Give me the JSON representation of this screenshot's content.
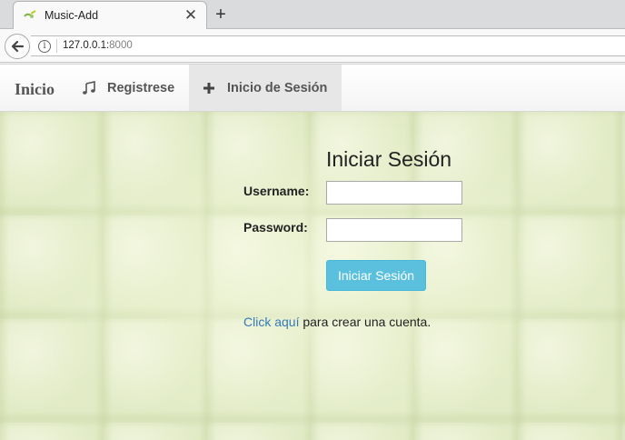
{
  "browser": {
    "tab_title": "Music-Add",
    "close_glyph": "✕",
    "newtab_glyph": "+",
    "url_host": "127.0.0.1:",
    "url_port": "8000"
  },
  "navbar": {
    "brand": "Inicio",
    "register_label": "Registrese",
    "register_icon": "music-note-icon",
    "login_label": "Inicio de Sesión",
    "login_icon": "plus-icon"
  },
  "login": {
    "title": "Iniciar Sesión",
    "username_label": "Username:",
    "username_value": "",
    "password_label": "Password:",
    "password_value": "",
    "submit_label": "Iniciar Sesión",
    "signup_link_text": "Click aquí",
    "signup_suffix": " para crear una cuenta."
  },
  "colors": {
    "button_bg": "#5bc0de",
    "link": "#337ab7",
    "page_bg": "#e2ebc6"
  }
}
